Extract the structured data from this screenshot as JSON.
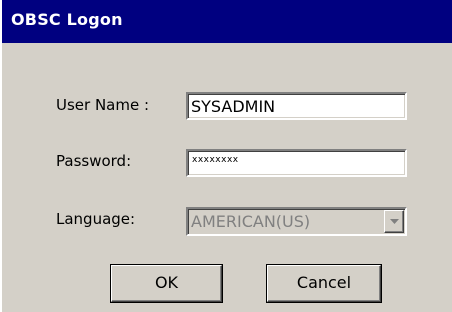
{
  "window": {
    "title": "OBSC Logon"
  },
  "form": {
    "username_label": "User Name :",
    "username_value": "SYSADMIN",
    "password_label": "Password:",
    "password_value": "xxxxxxxx",
    "language_label": "Language:",
    "language_value": "AMERICAN(US)",
    "language_icon": "chevron-down-icon"
  },
  "buttons": {
    "ok_label": "OK",
    "cancel_label": "Cancel"
  },
  "colors": {
    "titlebar": "#000080",
    "face": "#d4d0c8",
    "disabled_text": "#808080"
  }
}
